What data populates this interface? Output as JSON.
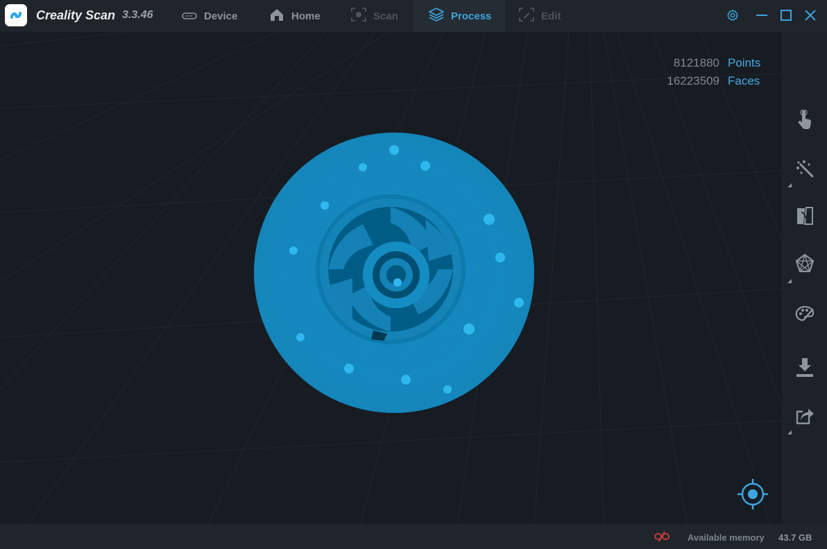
{
  "app": {
    "name": "Creality Scan",
    "version": "3.3.46"
  },
  "tabs": [
    {
      "label": "Device",
      "state": "normal",
      "icon": "device-icon"
    },
    {
      "label": "Home",
      "state": "normal",
      "icon": "home-icon"
    },
    {
      "label": "Scan",
      "state": "disabled",
      "icon": "scan-icon"
    },
    {
      "label": "Process",
      "state": "active",
      "icon": "layers-icon"
    },
    {
      "label": "Edit",
      "state": "disabled",
      "icon": "edit-icon"
    }
  ],
  "window_controls": [
    "settings-icon",
    "minimize-icon",
    "maximize-icon",
    "close-icon"
  ],
  "stats": {
    "points_value": "8121880",
    "points_label": "Points",
    "faces_value": "16223509",
    "faces_label": "Faces"
  },
  "toolbar": [
    "select-hand-tool",
    "magic-wand-tool",
    "mesh-tool",
    "model-net-tool",
    "texture-palette-tool",
    "download-tool",
    "export-share-tool"
  ],
  "status": {
    "memory_label": "Available memory",
    "memory_value": "43.7 GB"
  },
  "colors": {
    "accent": "#3fa4e0",
    "model": "#1f9fd8",
    "background": "#161c22"
  }
}
